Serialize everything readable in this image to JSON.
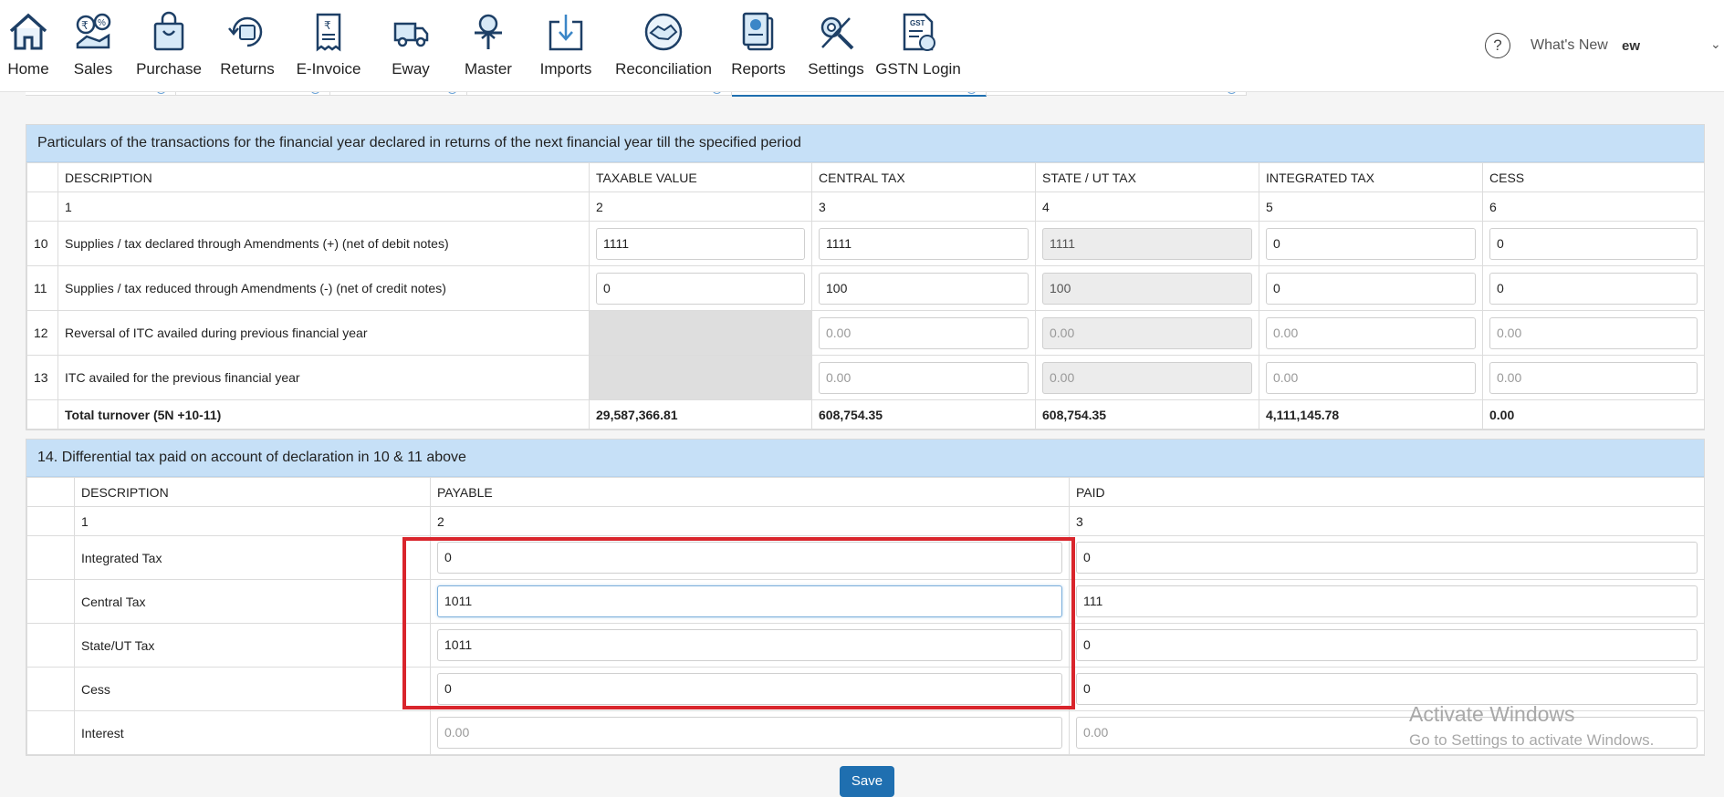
{
  "nav": [
    {
      "label": "Home",
      "icon": "home-icon"
    },
    {
      "label": "Sales",
      "icon": "sales-icon"
    },
    {
      "label": "Purchase",
      "icon": "shopping-bag-icon"
    },
    {
      "label": "Returns",
      "icon": "returns-icon"
    },
    {
      "label": "E-Invoice",
      "icon": "invoice-icon"
    },
    {
      "label": "Eway",
      "icon": "truck-icon"
    },
    {
      "label": "Master",
      "icon": "master-icon"
    },
    {
      "label": "Imports",
      "icon": "download-icon"
    },
    {
      "label": "Reconciliation",
      "icon": "handshake-icon"
    },
    {
      "label": "Reports",
      "icon": "reports-icon"
    },
    {
      "label": "Settings",
      "icon": "tools-icon"
    },
    {
      "label": "GSTN Login",
      "icon": "gst-document-icon"
    }
  ],
  "header_right": {
    "help": "?",
    "whats_new": "What's New",
    "user_fragment": "ew"
  },
  "colors": {
    "accent": "#1f6fb0",
    "panel_header": "#c6e0f7",
    "highlight": "#d9252c"
  },
  "section1": {
    "title": "Particulars of the transactions for the financial year declared in returns of the next financial year till the specified period",
    "headers": [
      "DESCRIPTION",
      "TAXABLE VALUE",
      "CENTRAL TAX",
      "STATE / UT TAX",
      "INTEGRATED TAX",
      "CESS"
    ],
    "numbers": [
      "1",
      "2",
      "3",
      "4",
      "5",
      "6"
    ],
    "rows": [
      {
        "no": "10",
        "desc": "Supplies / tax declared through Amendments (+) (net of debit notes)",
        "taxable": "1111",
        "central": "1111",
        "state": "1111",
        "integrated": "0",
        "cess": "0"
      },
      {
        "no": "11",
        "desc": "Supplies / tax reduced through Amendments (-) (net of credit notes)",
        "taxable": "0",
        "central": "100",
        "state": "100",
        "integrated": "0",
        "cess": "0"
      },
      {
        "no": "12",
        "desc": "Reversal of ITC availed during previous financial year",
        "central": "0.00",
        "state": "0.00",
        "integrated": "0.00",
        "cess": "0.00"
      },
      {
        "no": "13",
        "desc": "ITC availed for the previous financial year",
        "central": "0.00",
        "state": "0.00",
        "integrated": "0.00",
        "cess": "0.00"
      }
    ],
    "total": {
      "label": "Total turnover (5N +10-11)",
      "taxable": "29,587,366.81",
      "central": "608,754.35",
      "state": "608,754.35",
      "integrated": "4,111,145.78",
      "cess": "0.00"
    }
  },
  "section2": {
    "title": "14. Differential tax paid on account of declaration in 10 & 11 above",
    "headers": [
      "DESCRIPTION",
      "PAYABLE",
      "PAID"
    ],
    "numbers": [
      "1",
      "2",
      "3"
    ],
    "rows": [
      {
        "desc": "Integrated Tax",
        "payable": "0",
        "paid": "0"
      },
      {
        "desc": "Central Tax",
        "payable": "1011",
        "paid": "111"
      },
      {
        "desc": "State/UT Tax",
        "payable": "1011",
        "paid": "0"
      },
      {
        "desc": "Cess",
        "payable": "0",
        "paid": "0"
      },
      {
        "desc": "Interest",
        "payable": "0.00",
        "paid": "0.00"
      }
    ]
  },
  "save_label": "Save",
  "watermark": {
    "line1": "Activate Windows",
    "line2": "Go to Settings to activate Windows."
  }
}
